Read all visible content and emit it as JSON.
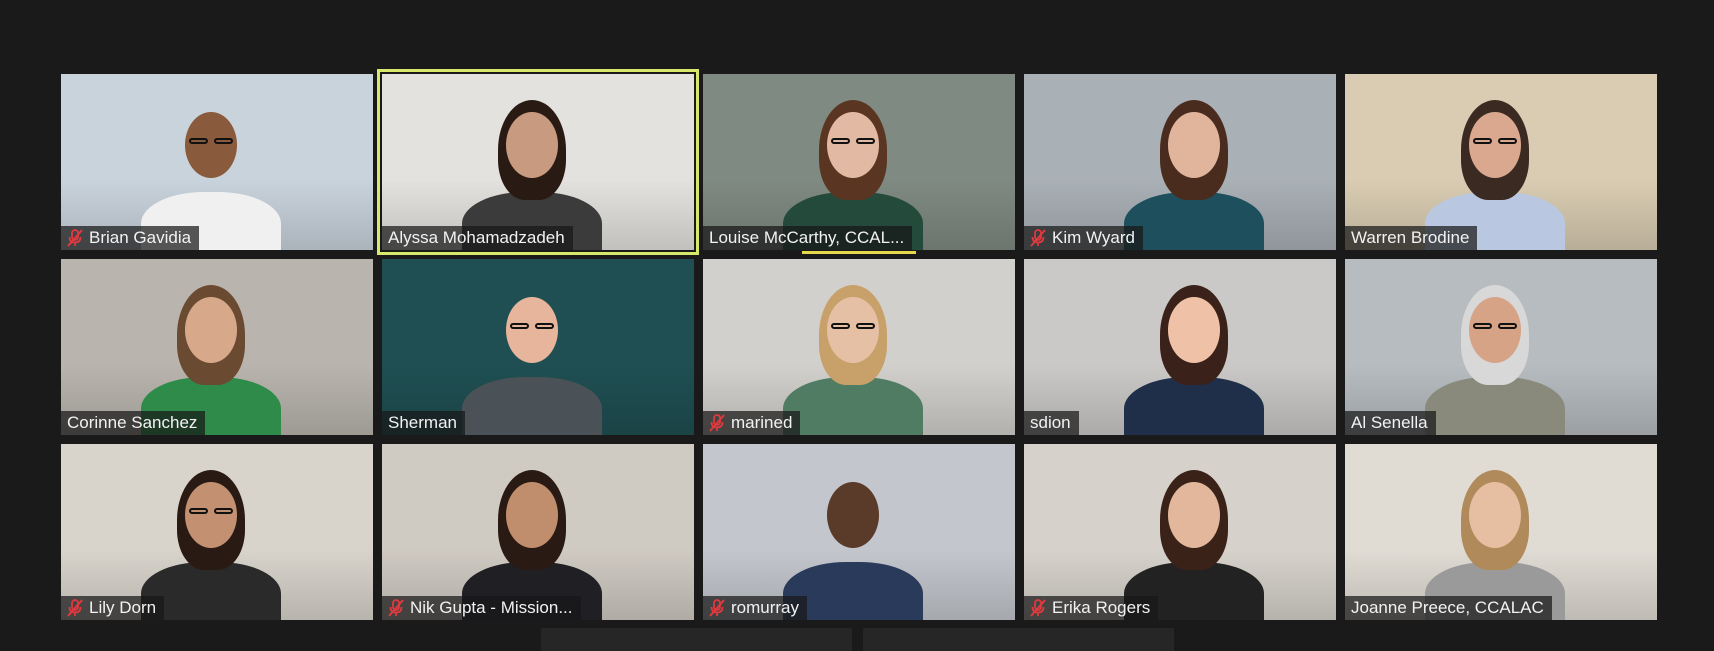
{
  "app": "Zoom gallery view",
  "participants": [
    {
      "name": "Brian Gavidia",
      "muted": true,
      "active": false,
      "bg": "#c9d3dc",
      "skin": "#8a5a3c",
      "hair": "#2a1a12",
      "shirt": "#f0f0f0",
      "bald": true,
      "glasses": true
    },
    {
      "name": "Alyssa Mohamadzadeh",
      "muted": false,
      "active": true,
      "bg": "#e4e2df",
      "skin": "#c89a80",
      "hair": "#2a1a14",
      "shirt": "#3b3b3b",
      "bald": false,
      "glasses": false
    },
    {
      "name": "Louise McCarthy, CCAL...",
      "muted": false,
      "active": false,
      "bg": "#7f8a82",
      "skin": "#e2b9a2",
      "hair": "#5a3622",
      "shirt": "#234a3a",
      "bald": false,
      "glasses": true
    },
    {
      "name": "Kim Wyard",
      "muted": true,
      "active": false,
      "bg": "#a9b0b6",
      "skin": "#e0b59c",
      "hair": "#4a2c1e",
      "shirt": "#1d4f5d",
      "bald": false,
      "glasses": false
    },
    {
      "name": "Warren Brodine",
      "muted": false,
      "active": false,
      "bg": "#d9ccb2",
      "skin": "#d9a88e",
      "hair": "#3a2a22",
      "shirt": "#b9c8e0",
      "bald": false,
      "glasses": true
    },
    {
      "name": "Corinne Sanchez",
      "muted": false,
      "active": false,
      "bg": "#b9b5ae",
      "skin": "#d7a889",
      "hair": "#6b4a32",
      "shirt": "#2e8b4a",
      "bald": false,
      "glasses": false
    },
    {
      "name": "Sherman",
      "muted": false,
      "active": false,
      "bg": "#1f4f52",
      "skin": "#e7b59b",
      "hair": "#c9c0b6",
      "shirt": "#4a5258",
      "bald": true,
      "glasses": true
    },
    {
      "name": "marined",
      "muted": true,
      "active": false,
      "bg": "#d2d0cc",
      "skin": "#e6c0a4",
      "hair": "#c8a06a",
      "shirt": "#4f7c63",
      "bald": false,
      "glasses": true
    },
    {
      "name": "sdion",
      "muted": false,
      "active": false,
      "bg": "#cbc9c7",
      "skin": "#efc2a8",
      "hair": "#3a221a",
      "shirt": "#1f2f4a",
      "bald": false,
      "glasses": false
    },
    {
      "name": "Al Senella",
      "muted": false,
      "active": false,
      "bg": "#b7bcc0",
      "skin": "#d6a386",
      "hair": "#d8d8d8",
      "shirt": "#8a8a7c",
      "bald": false,
      "glasses": true
    },
    {
      "name": "Lily Dorn",
      "muted": true,
      "active": false,
      "bg": "#d8d4cc",
      "skin": "#c49072",
      "hair": "#2a1a14",
      "shirt": "#2a2a2a",
      "bald": false,
      "glasses": true
    },
    {
      "name": "Nik Gupta - Mission...",
      "muted": true,
      "active": false,
      "bg": "#cfcac2",
      "skin": "#c08e6c",
      "hair": "#2a1a14",
      "shirt": "#1f1f24",
      "bald": false,
      "glasses": false
    },
    {
      "name": "romurray",
      "muted": true,
      "active": false,
      "bg": "#c3c6cc",
      "skin": "#5a3a28",
      "hair": "#1a1a1a",
      "shirt": "#2a3a5a",
      "bald": true,
      "glasses": false
    },
    {
      "name": "Erika Rogers",
      "muted": true,
      "active": false,
      "bg": "#d6d2cb",
      "skin": "#e3b79c",
      "hair": "#3a2218",
      "shirt": "#222222",
      "bald": false,
      "glasses": false
    },
    {
      "name": "Joanne Preece, CCALAC",
      "muted": false,
      "active": false,
      "bg": "#e0dcd4",
      "skin": "#e6bea2",
      "hair": "#b08a5a",
      "shirt": "#9a9a9a",
      "bald": false,
      "glasses": false
    }
  ],
  "colors": {
    "background": "#1a1a1a",
    "active_border": "#d7e86a",
    "speaking_indicator": "#e6d84a",
    "mute_icon": "#e0393e"
  }
}
